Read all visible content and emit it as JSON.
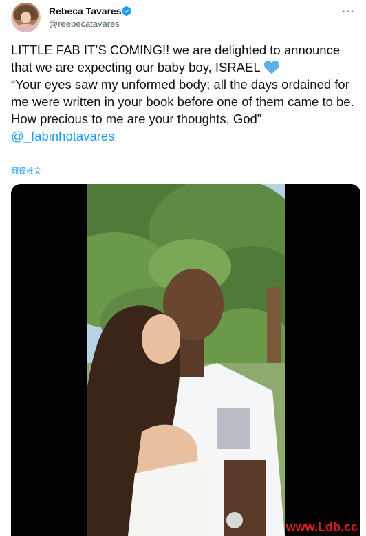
{
  "author": {
    "name": "Rebeca Tavares",
    "handle": "@reebecatavares",
    "verified": true
  },
  "tweet": {
    "text_part1": "LITTLE FAB IT’S COMING!! we are delighted to announce that we are expecting our baby boy, ISRAEL ",
    "heart_icon": "blue-heart-icon",
    "text_part2": "\n“Your eyes saw my unformed body; all the days ordained for me were written in your book before one of them came to be. How precious to me are your thoughts, God” ",
    "mention": "@_fabinhotavares",
    "translate_label": "翻译推文"
  },
  "media": {
    "type": "video",
    "description_icon": "photo-of-couple-kissing-outdoors"
  },
  "watermark": "www.Ldb.cc",
  "colors": {
    "accent": "#1d9bf0",
    "text": "#0f1419",
    "secondary": "#536471",
    "watermark": "#e02020"
  }
}
